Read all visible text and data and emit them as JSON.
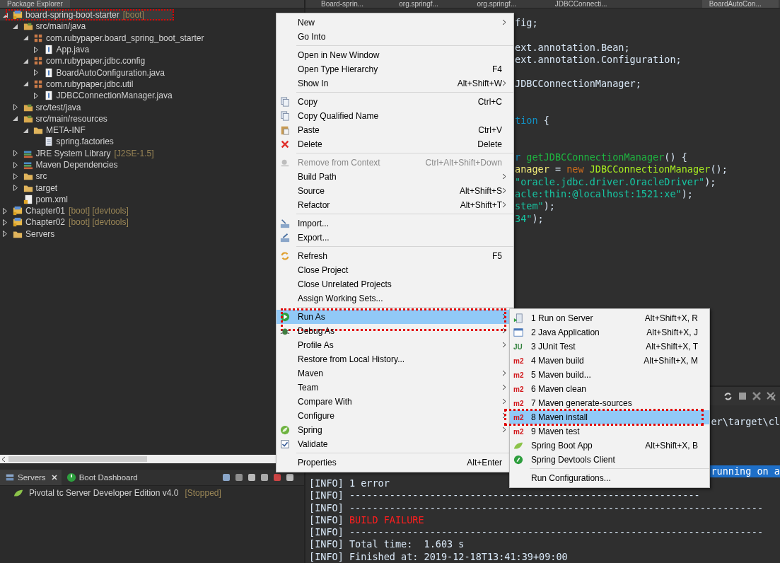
{
  "package_explorer": {
    "title": "Package Explorer",
    "tree": [
      {
        "label": "board-spring-boot-starter",
        "decoration": "[boot]",
        "kind": "project",
        "expanded": true,
        "selected": true,
        "marked": true,
        "children": [
          {
            "label": "src/main/java",
            "kind": "src-folder",
            "expanded": true,
            "selected": false,
            "children": [
              {
                "label": "com.rubypaper.board_spring_boot_starter",
                "kind": "package",
                "expanded": true,
                "selected": false,
                "children": [
                  {
                    "label": "App.java",
                    "kind": "java-file",
                    "expanded": false,
                    "selected": false
                  }
                ]
              },
              {
                "label": "com.rubypaper.jdbc.config",
                "kind": "package",
                "expanded": true,
                "selected": false,
                "children": [
                  {
                    "label": "BoardAutoConfiguration.java",
                    "kind": "java-file",
                    "expanded": false,
                    "selected": false
                  }
                ]
              },
              {
                "label": "com.rubypaper.jdbc.util",
                "kind": "package",
                "expanded": true,
                "selected": false,
                "children": [
                  {
                    "label": "JDBCConnectionManager.java",
                    "kind": "java-file",
                    "expanded": false,
                    "selected": false
                  }
                ]
              }
            ]
          },
          {
            "label": "src/test/java",
            "kind": "src-folder",
            "expanded": false,
            "selected": false
          },
          {
            "label": "src/main/resources",
            "kind": "src-folder",
            "expanded": true,
            "selected": false,
            "children": [
              {
                "label": "META-INF",
                "kind": "folder",
                "expanded": true,
                "selected": false,
                "children": [
                  {
                    "label": "spring.factories",
                    "kind": "file",
                    "selected": false
                  }
                ]
              }
            ]
          },
          {
            "label": "JRE System Library",
            "decoration": "[J2SE-1.5]",
            "kind": "library",
            "expanded": false,
            "selected": false
          },
          {
            "label": "Maven Dependencies",
            "kind": "library",
            "expanded": false,
            "selected": false
          },
          {
            "label": "src",
            "kind": "folder",
            "expanded": false,
            "selected": false
          },
          {
            "label": "target",
            "kind": "folder",
            "expanded": false,
            "selected": false
          },
          {
            "label": "pom.xml",
            "kind": "xml",
            "selected": false
          }
        ]
      },
      {
        "label": "Chapter01",
        "decoration": "[boot] [devtools]",
        "kind": "project",
        "expanded": false,
        "selected": false
      },
      {
        "label": "Chapter02",
        "decoration": "[boot] [devtools]",
        "kind": "project",
        "expanded": false,
        "selected": false
      },
      {
        "label": "Servers",
        "kind": "folder",
        "expanded": false,
        "selected": false
      }
    ]
  },
  "editor": {
    "tabs": [
      {
        "label": "Board-sprin...",
        "selected": false
      },
      {
        "label": "org.springf...",
        "selected": false
      },
      {
        "label": "org.springf...",
        "selected": false
      },
      {
        "label": "JDBCConnecti...",
        "selected": false
      },
      {
        "label": "BoardAutoCon...",
        "selected": true
      }
    ],
    "lines": [
      {
        "kind": "code",
        "segments": [
          {
            "text": "fig;",
            "kind": "plain"
          }
        ]
      },
      {
        "kind": "blank"
      },
      {
        "kind": "code",
        "segments": [
          {
            "text": "ext.annotation.Bean;",
            "kind": "plain"
          }
        ]
      },
      {
        "kind": "code",
        "segments": [
          {
            "text": "ext.annotation.Configuration;",
            "kind": "plain"
          }
        ]
      },
      {
        "kind": "blank"
      },
      {
        "kind": "code",
        "segments": [
          {
            "text": "JDBCConnectionManager;",
            "kind": "plain"
          }
        ]
      },
      {
        "kind": "blank"
      },
      {
        "kind": "blank"
      },
      {
        "kind": "code",
        "segments": [
          {
            "text": "tion",
            "kind": "type"
          },
          {
            "text": " {",
            "kind": "plain"
          }
        ]
      },
      {
        "kind": "blank"
      },
      {
        "kind": "blank"
      },
      {
        "kind": "code",
        "segments": [
          {
            "text": "r",
            "kind": "type"
          },
          {
            "text": " getJDBCConnectionManager",
            "kind": "method"
          },
          {
            "text": "() {",
            "kind": "plain"
          }
        ]
      },
      {
        "kind": "code",
        "segments": [
          {
            "text": "anager",
            "kind": "variable"
          },
          {
            "text": " = ",
            "kind": "plain"
          },
          {
            "text": "new",
            "kind": "keyword"
          },
          {
            "text": " JDBCConnectionManager",
            "kind": "class"
          },
          {
            "text": "();",
            "kind": "plain"
          }
        ]
      },
      {
        "kind": "code",
        "segments": [
          {
            "text": "\"oracle.jdbc.driver.OracleDriver\"",
            "kind": "string"
          },
          {
            "text": ");",
            "kind": "plain"
          }
        ]
      },
      {
        "kind": "code",
        "segments": [
          {
            "text": "acle:thin:@localhost:1521:xe\"",
            "kind": "string"
          },
          {
            "text": ");",
            "kind": "plain"
          }
        ]
      },
      {
        "kind": "code",
        "segments": [
          {
            "text": "stem\"",
            "kind": "string"
          },
          {
            "text": ");",
            "kind": "plain"
          }
        ]
      },
      {
        "kind": "code",
        "segments": [
          {
            "text": "34\"",
            "kind": "string"
          },
          {
            "text": ");",
            "kind": "plain"
          }
        ]
      }
    ]
  },
  "console": {
    "tail_lines": [
      {
        "text": "er\\target\\cl",
        "selected": false
      },
      {
        "text": "running on a",
        "selected": true
      }
    ],
    "lines": [
      [
        {
          "text": "[INFO] 1 error",
          "kind": "plain"
        }
      ],
      [
        {
          "text": "[INFO] -------------------------------------------------------------",
          "kind": "plain"
        }
      ],
      [
        {
          "text": "[INFO] ------------------------------------------------------------------------",
          "kind": "plain"
        }
      ],
      [
        {
          "text": "[INFO] ",
          "kind": "plain"
        },
        {
          "text": "BUILD FAILURE",
          "kind": "error"
        }
      ],
      [
        {
          "text": "[INFO] ------------------------------------------------------------------------",
          "kind": "plain"
        }
      ],
      [
        {
          "text": "[INFO] Total time:  1.603 s",
          "kind": "plain"
        }
      ],
      [
        {
          "text": "[INFO] Finished at: 2019-12-18T13:41:39+09:00",
          "kind": "plain"
        }
      ]
    ]
  },
  "servers_view": {
    "tabs": [
      {
        "label": "Servers",
        "kind": "servers",
        "selected": true
      },
      {
        "label": "Boot Dashboard",
        "kind": "power",
        "selected": false
      }
    ],
    "rows": [
      {
        "label": "Pivotal tc Server Developer Edition v4.0",
        "status": "[Stopped]"
      }
    ]
  },
  "context_menu": {
    "items": [
      {
        "kind": "item",
        "label": "New",
        "submenu": true,
        "disabled": false,
        "selected": false
      },
      {
        "kind": "item",
        "label": "Go Into",
        "submenu": false,
        "disabled": false,
        "selected": false
      },
      {
        "kind": "separator"
      },
      {
        "kind": "item",
        "label": "Open in New Window",
        "submenu": false,
        "disabled": false,
        "selected": false
      },
      {
        "kind": "item",
        "label": "Open Type Hierarchy",
        "shortcut": "F4",
        "submenu": false,
        "disabled": false,
        "selected": false
      },
      {
        "kind": "item",
        "label": "Show In",
        "shortcut": "Alt+Shift+W",
        "submenu": true,
        "disabled": false,
        "selected": false
      },
      {
        "kind": "separator"
      },
      {
        "kind": "copy",
        "label": "Copy",
        "shortcut": "Ctrl+C",
        "submenu": false,
        "disabled": false,
        "selected": false
      },
      {
        "kind": "copy",
        "label": "Copy Qualified Name",
        "submenu": false,
        "disabled": false,
        "selected": false
      },
      {
        "kind": "paste",
        "label": "Paste",
        "shortcut": "Ctrl+V",
        "submenu": false,
        "disabled": false,
        "selected": false
      },
      {
        "kind": "delete",
        "label": "Delete",
        "shortcut": "Delete",
        "submenu": false,
        "disabled": false,
        "selected": false
      },
      {
        "kind": "separator"
      },
      {
        "kind": "remove",
        "label": "Remove from Context",
        "shortcut": "Ctrl+Alt+Shift+Down",
        "submenu": false,
        "disabled": true,
        "selected": false
      },
      {
        "kind": "item",
        "label": "Build Path",
        "submenu": true,
        "disabled": false,
        "selected": false
      },
      {
        "kind": "item",
        "label": "Source",
        "shortcut": "Alt+Shift+S",
        "submenu": true,
        "disabled": false,
        "selected": false
      },
      {
        "kind": "item",
        "label": "Refactor",
        "shortcut": "Alt+Shift+T",
        "submenu": true,
        "disabled": false,
        "selected": false
      },
      {
        "kind": "separator"
      },
      {
        "kind": "import",
        "label": "Import...",
        "submenu": false,
        "disabled": false,
        "selected": false
      },
      {
        "kind": "export",
        "label": "Export...",
        "submenu": false,
        "disabled": false,
        "selected": false
      },
      {
        "kind": "separator"
      },
      {
        "kind": "refresh",
        "label": "Refresh",
        "shortcut": "F5",
        "submenu": false,
        "disabled": false,
        "selected": false
      },
      {
        "kind": "item",
        "label": "Close Project",
        "submenu": false,
        "disabled": false,
        "selected": false
      },
      {
        "kind": "item",
        "label": "Close Unrelated Projects",
        "submenu": false,
        "disabled": false,
        "selected": false
      },
      {
        "kind": "item",
        "label": "Assign Working Sets...",
        "submenu": false,
        "disabled": false,
        "selected": false
      },
      {
        "kind": "separator"
      },
      {
        "kind": "run",
        "label": "Run As",
        "submenu": true,
        "disabled": false,
        "selected": true,
        "marked": true
      },
      {
        "kind": "debug",
        "label": "Debug As",
        "submenu": true,
        "disabled": false,
        "selected": false
      },
      {
        "kind": "item",
        "label": "Profile As",
        "submenu": true,
        "disabled": false,
        "selected": false
      },
      {
        "kind": "item",
        "label": "Restore from Local History...",
        "submenu": false,
        "disabled": false,
        "selected": false
      },
      {
        "kind": "item",
        "label": "Maven",
        "submenu": true,
        "disabled": false,
        "selected": false
      },
      {
        "kind": "item",
        "label": "Team",
        "submenu": true,
        "disabled": false,
        "selected": false
      },
      {
        "kind": "item",
        "label": "Compare With",
        "submenu": true,
        "disabled": false,
        "selected": false
      },
      {
        "kind": "item",
        "label": "Configure",
        "submenu": true,
        "disabled": false,
        "selected": false
      },
      {
        "kind": "spring",
        "label": "Spring",
        "submenu": true,
        "disabled": false,
        "selected": false
      },
      {
        "kind": "validate",
        "label": "Validate",
        "submenu": false,
        "disabled": false,
        "selected": false
      },
      {
        "kind": "separator"
      },
      {
        "kind": "item",
        "label": "Properties",
        "shortcut": "Alt+Enter",
        "submenu": false,
        "disabled": false,
        "selected": false
      }
    ]
  },
  "run_as_submenu": {
    "items": [
      {
        "kind": "server",
        "label": "1 Run on Server",
        "shortcut": "Alt+Shift+X, R",
        "selected": false
      },
      {
        "kind": "java-app",
        "label": "2 Java Application",
        "shortcut": "Alt+Shift+X, J",
        "selected": false
      },
      {
        "kind": "junit",
        "icon_text": "JU",
        "label": "3 JUnit Test",
        "shortcut": "Alt+Shift+X, T",
        "selected": false
      },
      {
        "kind": "maven",
        "icon_text": "m2",
        "label": "4 Maven build",
        "shortcut": "Alt+Shift+X, M",
        "selected": false
      },
      {
        "kind": "maven",
        "icon_text": "m2",
        "label": "5 Maven build...",
        "selected": false
      },
      {
        "kind": "maven",
        "icon_text": "m2",
        "label": "6 Maven clean",
        "selected": false
      },
      {
        "kind": "maven",
        "icon_text": "m2",
        "label": "7 Maven generate-sources",
        "selected": false
      },
      {
        "kind": "maven",
        "icon_text": "m2",
        "label": "8 Maven install",
        "selected": true,
        "marked": true
      },
      {
        "kind": "maven",
        "icon_text": "m2",
        "label": "9 Maven test",
        "selected": false
      },
      {
        "kind": "boot",
        "label": "Spring Boot App",
        "shortcut": "Alt+Shift+X, B",
        "selected": false
      },
      {
        "kind": "devtools",
        "label": "Spring Devtools Client",
        "selected": false
      },
      {
        "kind": "separator"
      },
      {
        "kind": "item",
        "label": "Run Configurations...",
        "selected": false
      }
    ]
  }
}
